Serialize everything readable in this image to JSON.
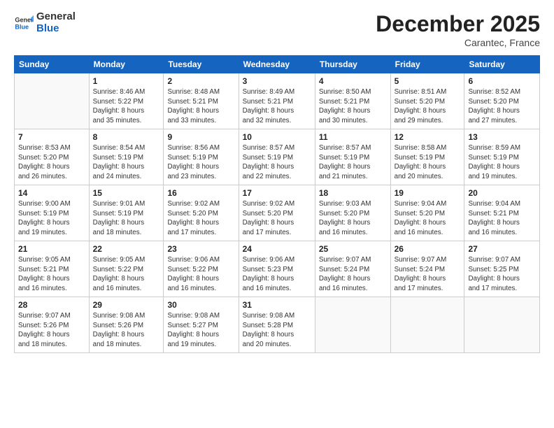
{
  "header": {
    "logo": {
      "line1": "General",
      "line2": "Blue"
    },
    "title": "December 2025",
    "location": "Carantec, France"
  },
  "weekdays": [
    "Sunday",
    "Monday",
    "Tuesday",
    "Wednesday",
    "Thursday",
    "Friday",
    "Saturday"
  ],
  "weeks": [
    [
      {
        "day": "",
        "info": ""
      },
      {
        "day": "1",
        "info": "Sunrise: 8:46 AM\nSunset: 5:22 PM\nDaylight: 8 hours\nand 35 minutes."
      },
      {
        "day": "2",
        "info": "Sunrise: 8:48 AM\nSunset: 5:21 PM\nDaylight: 8 hours\nand 33 minutes."
      },
      {
        "day": "3",
        "info": "Sunrise: 8:49 AM\nSunset: 5:21 PM\nDaylight: 8 hours\nand 32 minutes."
      },
      {
        "day": "4",
        "info": "Sunrise: 8:50 AM\nSunset: 5:21 PM\nDaylight: 8 hours\nand 30 minutes."
      },
      {
        "day": "5",
        "info": "Sunrise: 8:51 AM\nSunset: 5:20 PM\nDaylight: 8 hours\nand 29 minutes."
      },
      {
        "day": "6",
        "info": "Sunrise: 8:52 AM\nSunset: 5:20 PM\nDaylight: 8 hours\nand 27 minutes."
      }
    ],
    [
      {
        "day": "7",
        "info": "Sunrise: 8:53 AM\nSunset: 5:20 PM\nDaylight: 8 hours\nand 26 minutes."
      },
      {
        "day": "8",
        "info": "Sunrise: 8:54 AM\nSunset: 5:19 PM\nDaylight: 8 hours\nand 24 minutes."
      },
      {
        "day": "9",
        "info": "Sunrise: 8:56 AM\nSunset: 5:19 PM\nDaylight: 8 hours\nand 23 minutes."
      },
      {
        "day": "10",
        "info": "Sunrise: 8:57 AM\nSunset: 5:19 PM\nDaylight: 8 hours\nand 22 minutes."
      },
      {
        "day": "11",
        "info": "Sunrise: 8:57 AM\nSunset: 5:19 PM\nDaylight: 8 hours\nand 21 minutes."
      },
      {
        "day": "12",
        "info": "Sunrise: 8:58 AM\nSunset: 5:19 PM\nDaylight: 8 hours\nand 20 minutes."
      },
      {
        "day": "13",
        "info": "Sunrise: 8:59 AM\nSunset: 5:19 PM\nDaylight: 8 hours\nand 19 minutes."
      }
    ],
    [
      {
        "day": "14",
        "info": "Sunrise: 9:00 AM\nSunset: 5:19 PM\nDaylight: 8 hours\nand 19 minutes."
      },
      {
        "day": "15",
        "info": "Sunrise: 9:01 AM\nSunset: 5:19 PM\nDaylight: 8 hours\nand 18 minutes."
      },
      {
        "day": "16",
        "info": "Sunrise: 9:02 AM\nSunset: 5:20 PM\nDaylight: 8 hours\nand 17 minutes."
      },
      {
        "day": "17",
        "info": "Sunrise: 9:02 AM\nSunset: 5:20 PM\nDaylight: 8 hours\nand 17 minutes."
      },
      {
        "day": "18",
        "info": "Sunrise: 9:03 AM\nSunset: 5:20 PM\nDaylight: 8 hours\nand 16 minutes."
      },
      {
        "day": "19",
        "info": "Sunrise: 9:04 AM\nSunset: 5:20 PM\nDaylight: 8 hours\nand 16 minutes."
      },
      {
        "day": "20",
        "info": "Sunrise: 9:04 AM\nSunset: 5:21 PM\nDaylight: 8 hours\nand 16 minutes."
      }
    ],
    [
      {
        "day": "21",
        "info": "Sunrise: 9:05 AM\nSunset: 5:21 PM\nDaylight: 8 hours\nand 16 minutes."
      },
      {
        "day": "22",
        "info": "Sunrise: 9:05 AM\nSunset: 5:22 PM\nDaylight: 8 hours\nand 16 minutes."
      },
      {
        "day": "23",
        "info": "Sunrise: 9:06 AM\nSunset: 5:22 PM\nDaylight: 8 hours\nand 16 minutes."
      },
      {
        "day": "24",
        "info": "Sunrise: 9:06 AM\nSunset: 5:23 PM\nDaylight: 8 hours\nand 16 minutes."
      },
      {
        "day": "25",
        "info": "Sunrise: 9:07 AM\nSunset: 5:24 PM\nDaylight: 8 hours\nand 16 minutes."
      },
      {
        "day": "26",
        "info": "Sunrise: 9:07 AM\nSunset: 5:24 PM\nDaylight: 8 hours\nand 17 minutes."
      },
      {
        "day": "27",
        "info": "Sunrise: 9:07 AM\nSunset: 5:25 PM\nDaylight: 8 hours\nand 17 minutes."
      }
    ],
    [
      {
        "day": "28",
        "info": "Sunrise: 9:07 AM\nSunset: 5:26 PM\nDaylight: 8 hours\nand 18 minutes."
      },
      {
        "day": "29",
        "info": "Sunrise: 9:08 AM\nSunset: 5:26 PM\nDaylight: 8 hours\nand 18 minutes."
      },
      {
        "day": "30",
        "info": "Sunrise: 9:08 AM\nSunset: 5:27 PM\nDaylight: 8 hours\nand 19 minutes."
      },
      {
        "day": "31",
        "info": "Sunrise: 9:08 AM\nSunset: 5:28 PM\nDaylight: 8 hours\nand 20 minutes."
      },
      {
        "day": "",
        "info": ""
      },
      {
        "day": "",
        "info": ""
      },
      {
        "day": "",
        "info": ""
      }
    ]
  ]
}
